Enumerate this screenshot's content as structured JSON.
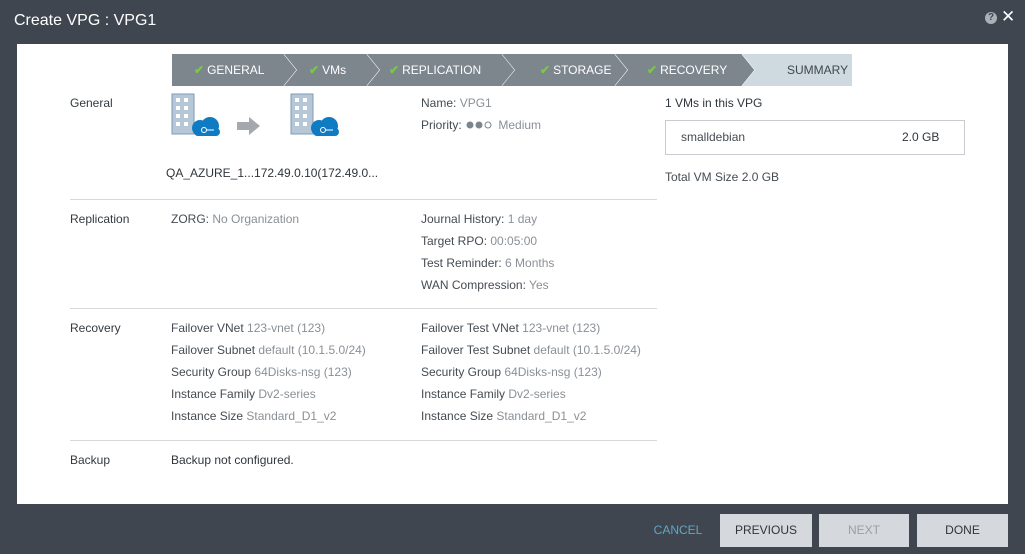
{
  "window": {
    "title": "Create VPG : VPG1",
    "help_icon": "?",
    "close_icon": "✕"
  },
  "wizard": {
    "steps": [
      {
        "label": "GENERAL",
        "state": "complete"
      },
      {
        "label": "VMs",
        "state": "complete"
      },
      {
        "label": "REPLICATION",
        "state": "complete"
      },
      {
        "label": "STORAGE",
        "state": "complete"
      },
      {
        "label": "RECOVERY",
        "state": "complete"
      },
      {
        "label": "SUMMARY",
        "state": "current"
      }
    ],
    "check_glyph": "✔",
    "colors": {
      "done": "#7d858d",
      "current": "#cfd9e0",
      "check": "#7ac943"
    }
  },
  "general": {
    "heading": "General",
    "site_pair": "QA_AZURE_1...172.49.0.10(172.49.0...",
    "name_label": "Name:",
    "name_value": "VPG1",
    "priority_label": "Priority:",
    "priority_value": "Medium",
    "priority_level": 2,
    "priority_max": 3
  },
  "vms_panel": {
    "title": "1 VMs in this VPG",
    "vms": [
      {
        "name": "smalldebian",
        "size": "2.0 GB"
      }
    ],
    "total": "Total VM Size 2.0 GB"
  },
  "replication": {
    "heading": "Replication",
    "zorg_label": "ZORG:",
    "zorg_value": "No Organization",
    "journal_label": "Journal History:",
    "journal_value": "1 day",
    "rpo_label": "Target RPO:",
    "rpo_value": "00:05:00",
    "test_label": "Test Reminder:",
    "test_value": "6 Months",
    "wan_label": "WAN Compression:",
    "wan_value": "Yes"
  },
  "recovery": {
    "heading": "Recovery",
    "left": [
      {
        "label": "Failover VNet",
        "value": "123-vnet (123)"
      },
      {
        "label": "Failover Subnet",
        "value": "default (10.1.5.0/24)"
      },
      {
        "label": "Security Group",
        "value": "64Disks-nsg (123)"
      },
      {
        "label": "Instance Family",
        "value": "Dv2-series"
      },
      {
        "label": "Instance Size",
        "value": "Standard_D1_v2"
      }
    ],
    "right": [
      {
        "label": "Failover Test VNet",
        "value": "123-vnet (123)"
      },
      {
        "label": "Failover Test Subnet",
        "value": "default (10.1.5.0/24)"
      },
      {
        "label": "Security Group",
        "value": "64Disks-nsg (123)"
      },
      {
        "label": "Instance Family",
        "value": "Dv2-series"
      },
      {
        "label": "Instance Size",
        "value": "Standard_D1_v2"
      }
    ]
  },
  "backup": {
    "heading": "Backup",
    "value": "Backup not configured."
  },
  "footer": {
    "cancel": "CANCEL",
    "previous": "PREVIOUS",
    "next": "NEXT",
    "done": "DONE"
  }
}
